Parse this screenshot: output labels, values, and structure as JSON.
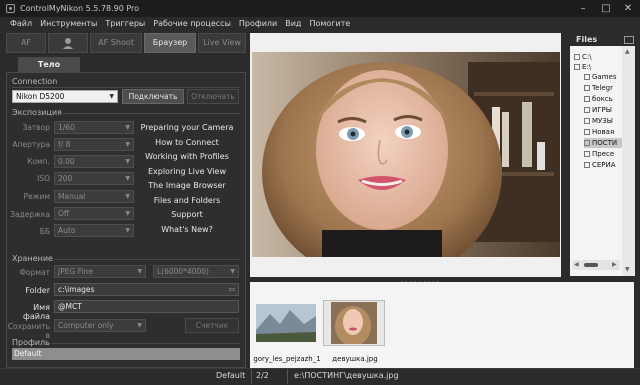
{
  "window": {
    "title": "ControlMyNikon 5.5.78.90 Pro",
    "minimize": "–",
    "maximize": "□",
    "close": "✕"
  },
  "menu": [
    "Файл",
    "Инструменты",
    "Триггеры",
    "Рабочие процессы",
    "Профили",
    "Вид",
    "Помогите"
  ],
  "modes": {
    "af": "AF",
    "af_shoot": "AF Shoot",
    "browser": "Браузер",
    "live_view": "Live View"
  },
  "body_tab": "Тело",
  "connection": {
    "section": "Connection",
    "camera": "Nikon D5200",
    "connect": "Подключать",
    "disconnect": "Отключать"
  },
  "exposure": {
    "section": "Экспозиция",
    "rows": [
      {
        "label": "Затвор",
        "value": "1/60"
      },
      {
        "label": "Апертура",
        "value": "f/ 8"
      },
      {
        "label": "Комп.",
        "value": "0.00"
      },
      {
        "label": "ISO",
        "value": "200"
      },
      {
        "label": "Режим",
        "value": "Manual"
      },
      {
        "label": "Задержка",
        "value": "Off"
      },
      {
        "label": "ББ",
        "value": "Auto"
      }
    ]
  },
  "links": [
    "Preparing your Camera",
    "How to Connect",
    "Working with Profiles",
    "Exploring Live View",
    "The Image Browser",
    "Files and Folders",
    "Support",
    "What's New?"
  ],
  "storage": {
    "section": "Хранение",
    "format_label": "Формат",
    "format_value": "JPEG Fine",
    "size_value": "L(6000*4000)",
    "folder_label": "Folder",
    "folder_value": "c:\\images",
    "filename_label": "Имя файла",
    "filename_value": "@MCT",
    "save_label": "Сохранить в",
    "save_value": "Computer only",
    "counter": "Счетчик"
  },
  "profile": {
    "section": "Профиль",
    "value": "Default"
  },
  "files": {
    "title": "Files",
    "tree": [
      {
        "label": "C:\\",
        "indent": 0
      },
      {
        "label": "E:\\",
        "indent": 0
      },
      {
        "label": "Games",
        "indent": 1
      },
      {
        "label": "Telegr",
        "indent": 1
      },
      {
        "label": "боксь",
        "indent": 1
      },
      {
        "label": "ИГРЫ",
        "indent": 1
      },
      {
        "label": "МУЗЫ",
        "indent": 1
      },
      {
        "label": "Новая",
        "indent": 1
      },
      {
        "label": "ПОСТИ",
        "indent": 1,
        "selected": true
      },
      {
        "label": "Пресе",
        "indent": 1
      },
      {
        "label": "СЕРИА",
        "indent": 1
      }
    ]
  },
  "thumbnails": [
    {
      "caption": "gory_les_pejzazh_1"
    },
    {
      "caption": "девушка.jpg",
      "selected": true
    }
  ],
  "status": {
    "profile": "Default",
    "count": "2/2",
    "path": "e:\\ПОСТИНГ\\девушка.jpg"
  },
  "colors": {
    "background": "#2b2b2b",
    "panel": "#2e2e2e",
    "accent": "#5a5a5a"
  }
}
